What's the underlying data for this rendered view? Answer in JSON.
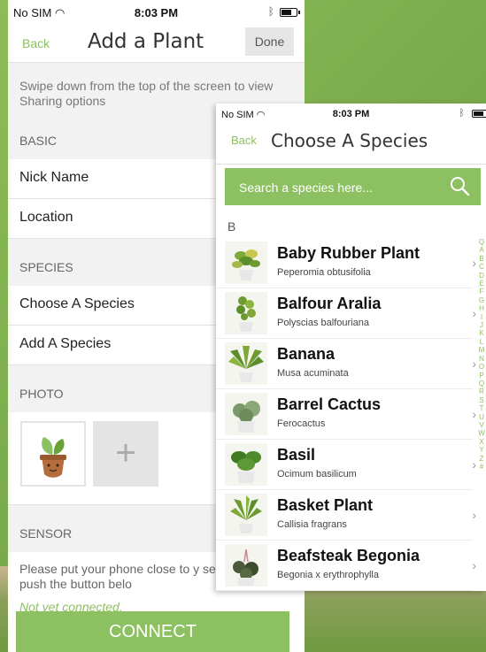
{
  "add_plant": {
    "status": {
      "carrier": "No SIM",
      "time": "8:03 PM"
    },
    "nav": {
      "back": "Back",
      "title": "Add a Plant",
      "done": "Done"
    },
    "hint": "Swipe down from the top of the screen to view Sharing options",
    "basic": {
      "header": "BASIC",
      "rows": [
        "Nick Name",
        "Location"
      ]
    },
    "species": {
      "header": "SPECIES",
      "rows": [
        "Choose A Species",
        "Add A Species"
      ]
    },
    "photo": {
      "header": "PHOTO",
      "add_symbol": "+"
    },
    "sensor": {
      "header": "SENSOR",
      "text": "Please put your phone close to y sensor and push the button belo",
      "status": "Not yet connected."
    },
    "connect_label": "CONNECT"
  },
  "choose_species": {
    "status": {
      "carrier": "No SIM",
      "time": "8:03 PM"
    },
    "nav": {
      "back": "Back",
      "title": "Choose A Species"
    },
    "search_placeholder": "Search a species here...",
    "section_letter": "B",
    "items": [
      {
        "name": "Baby Rubber Plant",
        "scientific": "Peperomia obtusifolia"
      },
      {
        "name": "Balfour Aralia",
        "scientific": "Polyscias balfouriana"
      },
      {
        "name": "Banana",
        "scientific": "Musa acuminata"
      },
      {
        "name": "Barrel Cactus",
        "scientific": "Ferocactus"
      },
      {
        "name": "Basil",
        "scientific": "Ocimum basilicum"
      },
      {
        "name": "Basket Plant",
        "scientific": "Callisia fragrans"
      },
      {
        "name": "Beafsteak Begonia",
        "scientific": "Begonia x erythrophylla"
      }
    ],
    "index_letters": [
      "Q",
      "A",
      "B",
      "C",
      "D",
      "E",
      "F",
      "G",
      "H",
      "I",
      "J",
      "K",
      "L",
      "M",
      "N",
      "O",
      "P",
      "Q",
      "R",
      "S",
      "T",
      "U",
      "V",
      "W",
      "X",
      "Y",
      "Z",
      "#"
    ]
  },
  "colors": {
    "accent": "#8cc061"
  },
  "icons": [
    "wifi-icon",
    "bluetooth-icon",
    "battery-icon",
    "search-icon",
    "chevron-right-icon",
    "plus-icon",
    "plant-pot-icon"
  ]
}
